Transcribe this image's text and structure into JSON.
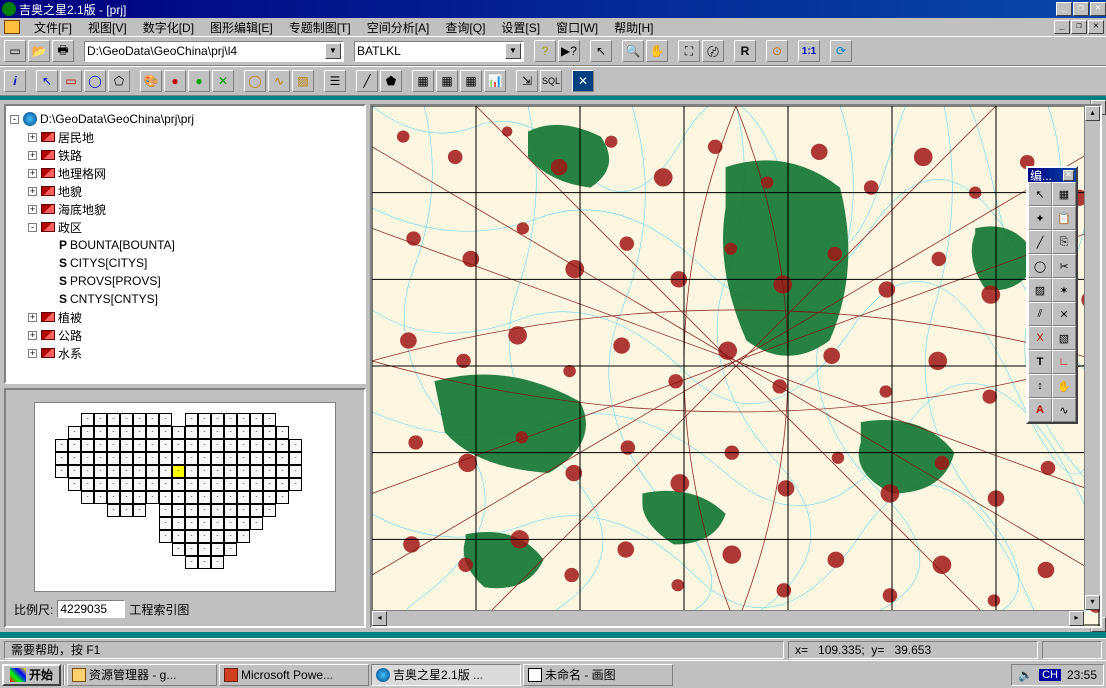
{
  "title": "吉奥之星2.1版 - [prj]",
  "menu": {
    "file": "文件[F]",
    "view": "视图[V]",
    "digitize": "数字化[D]",
    "graphedit": "图形编辑[E]",
    "thematic": "专题制图[T]",
    "spatial": "空间分析[A]",
    "query": "查询[Q]",
    "settings": "设置[S]",
    "window": "窗口[W]",
    "help": "帮助[H]"
  },
  "toolbar1": {
    "path": "D:\\GeoData\\GeoChina\\prj\\l4",
    "combo2": "BATLKL",
    "ratio_btn": "1:1",
    "r_btn": "R"
  },
  "toolbar2": {
    "sql_btn": "SQL"
  },
  "tree": {
    "root": "D:\\GeoData\\GeoChina\\prj\\prj",
    "nodes": [
      {
        "exp": "+",
        "label": "居民地"
      },
      {
        "exp": "+",
        "label": "铁路"
      },
      {
        "exp": "+",
        "label": "地理格网"
      },
      {
        "exp": "+",
        "label": "地貌"
      },
      {
        "exp": "+",
        "label": "海底地貌"
      },
      {
        "exp": "-",
        "label": "政区",
        "children": [
          {
            "icon": "P",
            "label": "BOUNTA[BOUNTA]"
          },
          {
            "icon": "S",
            "label": "CITYS[CITYS]"
          },
          {
            "icon": "S",
            "label": "PROVS[PROVS]"
          },
          {
            "icon": "S",
            "label": "CNTYS[CNTYS]"
          }
        ]
      },
      {
        "exp": "+",
        "label": "植被"
      },
      {
        "exp": "+",
        "label": "公路"
      },
      {
        "exp": "+",
        "label": "水系"
      }
    ]
  },
  "scale": {
    "label": "比例尺:",
    "value": "4229035",
    "idx_label": "工程索引图"
  },
  "palette": {
    "title": "编..."
  },
  "status": {
    "help": "需要帮助，按 F1",
    "coord_x_label": "x=",
    "coord_x": "109.335;",
    "coord_y_label": "y=",
    "coord_y": "39.653"
  },
  "taskbar": {
    "start": "开始",
    "tasks": [
      "资源管理器 - g...",
      "Microsoft Powe...",
      "吉奥之星2.1版 ...",
      "未命名 - 画图"
    ],
    "ime": "CH",
    "clock": "23:55"
  }
}
